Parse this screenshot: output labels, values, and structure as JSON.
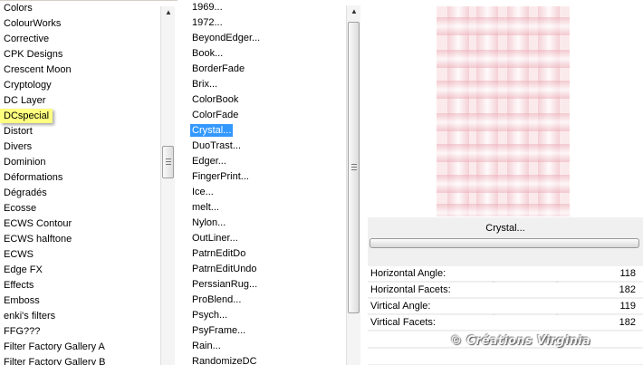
{
  "categories": [
    {
      "label": "Colors"
    },
    {
      "label": "ColourWorks"
    },
    {
      "label": "Corrective"
    },
    {
      "label": "CPK Designs"
    },
    {
      "label": "Crescent Moon"
    },
    {
      "label": "Cryptology"
    },
    {
      "label": "DC Layer"
    },
    {
      "label": "DCspecial",
      "selected": true
    },
    {
      "label": "Distort"
    },
    {
      "label": "Divers"
    },
    {
      "label": "Dominion"
    },
    {
      "label": "Déformations"
    },
    {
      "label": "Dégradés"
    },
    {
      "label": "Ecosse"
    },
    {
      "label": "ECWS Contour"
    },
    {
      "label": "ECWS halftone"
    },
    {
      "label": "ECWS"
    },
    {
      "label": "Edge FX"
    },
    {
      "label": "Effects"
    },
    {
      "label": "Emboss"
    },
    {
      "label": "enki's filters"
    },
    {
      "label": "FFG???"
    },
    {
      "label": "Filter Factory Gallery A"
    },
    {
      "label": "Filter Factory Gallery B"
    }
  ],
  "filters": [
    {
      "label": "1969..."
    },
    {
      "label": "1972..."
    },
    {
      "label": "BeyondEdger..."
    },
    {
      "label": "Book..."
    },
    {
      "label": "BorderFade"
    },
    {
      "label": "Brix..."
    },
    {
      "label": "ColorBook"
    },
    {
      "label": "ColorFade"
    },
    {
      "label": "Crystal...",
      "selected": true
    },
    {
      "label": "DuoTrast..."
    },
    {
      "label": "Edger..."
    },
    {
      "label": "FingerPrint..."
    },
    {
      "label": "Ice..."
    },
    {
      "label": "melt..."
    },
    {
      "label": "Nylon..."
    },
    {
      "label": "OutLiner..."
    },
    {
      "label": "PatrnEditDo"
    },
    {
      "label": "PatrnEditUndo"
    },
    {
      "label": "PerssianRug..."
    },
    {
      "label": "ProBlend..."
    },
    {
      "label": "Psych..."
    },
    {
      "label": "PsyFrame..."
    },
    {
      "label": "Rain..."
    },
    {
      "label": "RandomizeDC"
    }
  ],
  "selected_filter_title": "Crystal...",
  "parameters": [
    {
      "label": "Horizontal Angle:",
      "value": "118"
    },
    {
      "label": "Horizontal Facets:",
      "value": "182"
    },
    {
      "label": "Virtical Angle:",
      "value": "119"
    },
    {
      "label": "Virtical Facets:",
      "value": "182"
    }
  ],
  "watermark": "© Créations Virginia",
  "colors": {
    "selected_category_highlight": "#ffff80",
    "selected_filter_highlight": "#3399ff",
    "preview_base": "#fbeaec"
  },
  "icons": {
    "scroll_up": "scroll-up-arrow-icon",
    "scroll_grip": "scroll-grip-icon"
  }
}
